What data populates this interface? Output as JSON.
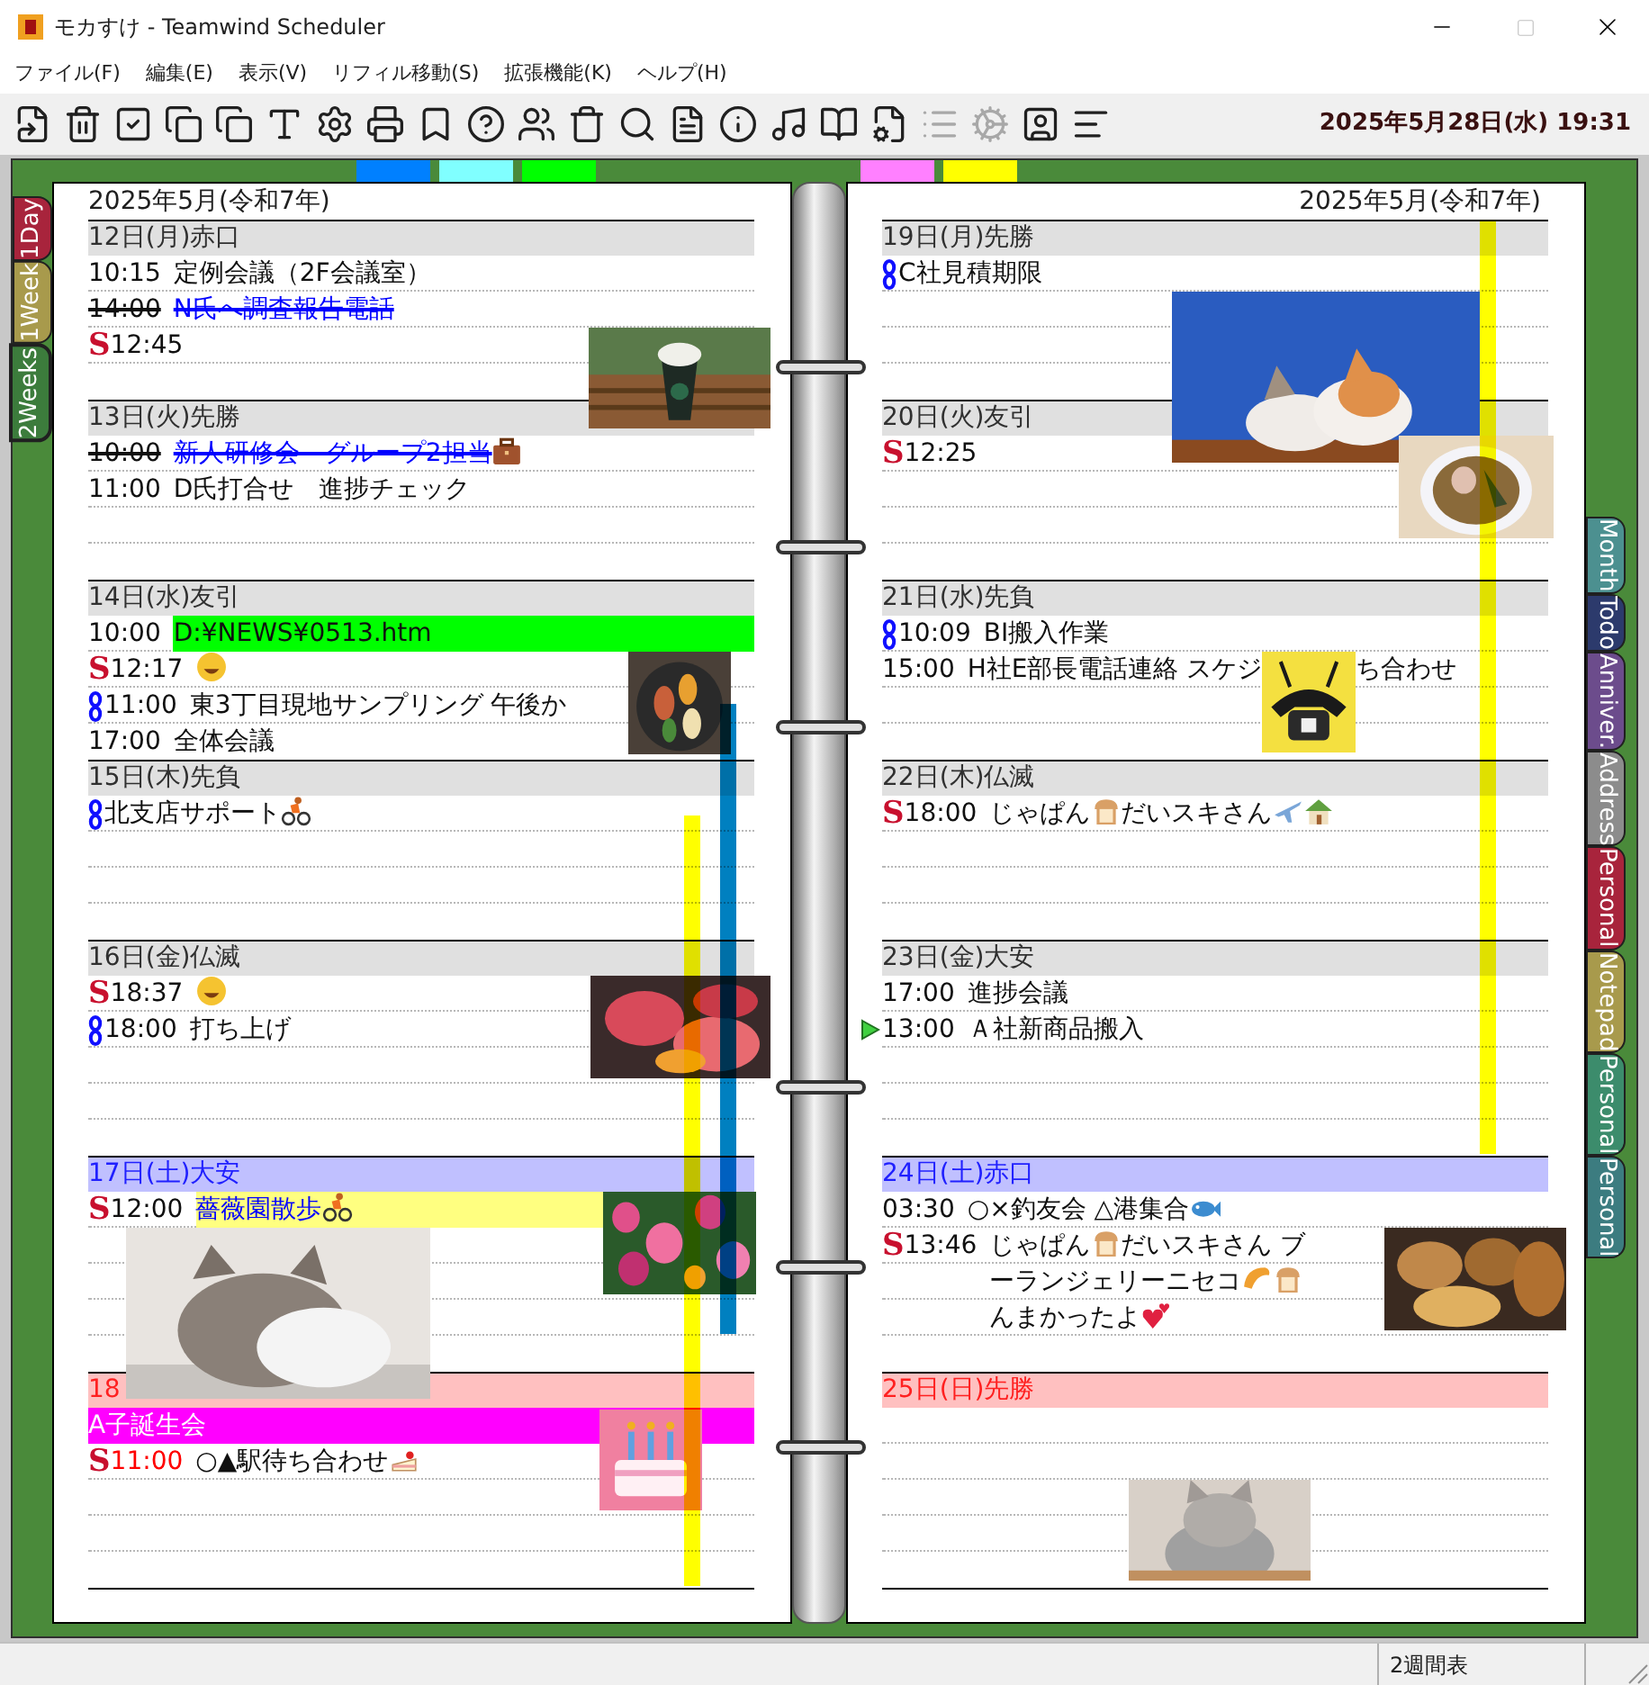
{
  "window": {
    "title": "モカすけ - Teamwind Scheduler"
  },
  "menu": [
    "ファイル(F)",
    "編集(E)",
    "表示(V)",
    "リフィル移動(S)",
    "拡張機能(K)",
    "ヘルプ(H)"
  ],
  "toolbar": [
    {
      "disabled": false
    },
    {
      "disabled": false
    },
    {
      "disabled": false
    },
    {
      "disabled": false
    },
    {
      "disabled": false
    },
    {
      "disabled": false
    },
    {
      "disabled": false
    },
    {
      "disabled": false
    },
    {
      "disabled": false
    },
    {
      "disabled": false
    },
    {
      "disabled": false
    },
    {
      "disabled": false
    },
    {
      "disabled": false
    },
    {
      "disabled": false
    },
    {
      "disabled": false
    },
    {
      "disabled": false
    },
    {
      "disabled": false
    },
    {
      "disabled": false
    },
    {
      "disabled": true
    },
    {
      "disabled": true
    },
    {
      "disabled": false
    },
    {
      "disabled": false
    }
  ],
  "clock": "2025年5月28日(水) 19:31",
  "top_markers": {
    "left": [
      {
        "color": "#0080ff"
      },
      {
        "color": "#80ffff"
      },
      {
        "color": "#00ff00"
      }
    ],
    "right": [
      {
        "color": "#ff80ff"
      },
      {
        "color": "#ffff00"
      }
    ]
  },
  "left_tabs": [
    {
      "label": "1Day",
      "color": "#a8243c",
      "selected": false
    },
    {
      "label": "1Week",
      "color": "#a89a4c",
      "selected": false
    },
    {
      "label": "2Weeks",
      "color": "#3c7c3c",
      "selected": true
    }
  ],
  "right_tabs": [
    {
      "label": "Month",
      "color": "#4c9090",
      "selected": false
    },
    {
      "label": "Todo",
      "color": "#2c3a6c",
      "selected": false
    },
    {
      "label": "Anniver.",
      "color": "#6c4c8c",
      "selected": false
    },
    {
      "label": "Address",
      "color": "#8c8c8c",
      "selected": false
    },
    {
      "label": "Personal",
      "color": "#a8243c",
      "selected": false
    },
    {
      "label": "Notepad",
      "color": "#a89a4c",
      "selected": false
    },
    {
      "label": "Personal",
      "color": "#3c8c6c",
      "selected": false
    },
    {
      "label": "Personal",
      "color": "#3c7c80",
      "selected": false
    }
  ],
  "pages": [
    {
      "month": "2025年5月(令和7年)",
      "period_bars": [
        {
          "color": "#ffff00"
        },
        {
          "color": "#0080c0"
        }
      ],
      "days": [
        {
          "header": "12日(月)赤口",
          "kind": "weekday",
          "entries": [
            {
              "kind": "plain",
              "time": "10:15",
              "parts": [
                {
                  "text": "定例会議（2F会議室）"
                }
              ],
              "strike": false
            },
            {
              "kind": "plain",
              "time": "14:00",
              "parts": [
                {
                  "text": "N氏へ調査報告電話"
                }
              ],
              "strike": true,
              "color": "#0000ff"
            },
            {
              "kind": "letter",
              "mark_text": "S",
              "time": "12:45",
              "strike": false
            }
          ]
        },
        {
          "header": "13日(火)先勝",
          "kind": "weekday",
          "entries": [
            {
              "kind": "plain",
              "time": "10:00",
              "parts": [
                {
                  "text": "新人研修会　グループ2担当"
                },
                {
                  "kind": "briefcase"
                }
              ],
              "strike": true,
              "color": "#0000ff"
            },
            {
              "kind": "plain",
              "time": "11:00",
              "parts": [
                {
                  "text": "D氏打合せ　進捗チェック"
                }
              ],
              "strike": false
            }
          ]
        },
        {
          "header": "14日(水)友引",
          "kind": "weekday",
          "entries": [
            {
              "kind": "plain",
              "time": "10:00",
              "parts": [
                {
                  "text": "D:¥NEWS¥0513.htm"
                }
              ],
              "strike": false,
              "highlight": {
                "color": "#00ff00"
              }
            },
            {
              "kind": "letter",
              "mark_text": "S",
              "time": "12:17",
              "parts": [
                {
                  "kind": "drool"
                }
              ],
              "strike": false
            },
            {
              "kind": "link",
              "time": "11:00",
              "parts": [
                {
                  "text": "東3丁目現地サンプリング 午後か"
                }
              ],
              "strike": false
            },
            {
              "kind": "plain",
              "time": "17:00",
              "parts": [
                {
                  "text": "全体会議"
                }
              ],
              "strike": false
            }
          ]
        },
        {
          "header": "15日(木)先負",
          "kind": "weekday",
          "entries": [
            {
              "kind": "link",
              "parts": [
                {
                  "text": "北支店サポート"
                },
                {
                  "kind": "cyclist"
                }
              ],
              "strike": false
            }
          ]
        },
        {
          "header": "16日(金)仏滅",
          "kind": "weekday",
          "entries": [
            {
              "kind": "letter",
              "mark_text": "S",
              "time": "18:37",
              "parts": [
                {
                  "kind": "grin"
                }
              ],
              "strike": false
            },
            {
              "kind": "link",
              "time": "18:00",
              "parts": [
                {
                  "text": "打ち上げ"
                }
              ],
              "strike": false
            }
          ]
        },
        {
          "header": "17日(土)大安",
          "kind": "saturday",
          "entries": [
            {
              "kind": "letter",
              "mark_text": "S",
              "time": "12:00",
              "parts": [
                {
                  "text": "薔薇園散歩"
                },
                {
                  "kind": "cyclist"
                }
              ],
              "strike": false,
              "highlight": {
                "color": "#ffff80"
              },
              "color": "#0000ff"
            }
          ]
        },
        {
          "header": "18",
          "kind": "sunday",
          "entries": [
            {
              "kind": "plain",
              "parts": [
                {
                  "text": "A子誕生会"
                }
              ],
              "strike": false,
              "highlight": {
                "color": "#ff00ff"
              },
              "color": "#ffffff"
            },
            {
              "kind": "letter",
              "mark_text": "S",
              "time": "11:00",
              "time_style": {
                "color": "#ff0000"
              },
              "parts": [
                {
                  "text": "○▲駅待ち合わせ"
                },
                {
                  "kind": "cake"
                }
              ],
              "strike": false
            }
          ]
        }
      ]
    },
    {
      "month": "2025年5月(令和7年)",
      "period_bars": [
        {
          "color": "#ffff00"
        }
      ],
      "days": [
        {
          "header": "19日(月)先勝",
          "kind": "weekday",
          "entries": [
            {
              "kind": "link",
              "parts": [
                {
                  "text": "C社見積期限"
                }
              ],
              "strike": false
            }
          ]
        },
        {
          "header": "20日(火)友引",
          "kind": "weekday",
          "entries": [
            {
              "kind": "letter",
              "mark_text": "S",
              "time": "12:25",
              "strike": false
            }
          ]
        },
        {
          "header": "21日(水)先負",
          "kind": "weekday",
          "entries": [
            {
              "kind": "link",
              "time": "10:09",
              "parts": [
                {
                  "text": "BI搬入作業"
                }
              ],
              "strike": false
            },
            {
              "kind": "plain",
              "time": "15:00",
              "parts": [
                {
                  "text": "H社E部長電話連絡 スケジ"
                },
                {
                  "kind": "picture"
                },
                {
                  "text": "ち合わせ"
                }
              ],
              "strike": false
            }
          ]
        },
        {
          "header": "22日(木)仏滅",
          "kind": "weekday",
          "entries": [
            {
              "kind": "letter",
              "mark_text": "S",
              "time": "18:00",
              "parts": [
                {
                  "text": "じゃぱん"
                },
                {
                  "kind": "bread"
                },
                {
                  "text": "だいスキさん"
                },
                {
                  "kind": "plane"
                },
                {
                  "kind": "house"
                }
              ],
              "strike": false
            }
          ]
        },
        {
          "header": "23日(金)大安",
          "kind": "weekday",
          "entries": [
            {
              "kind": "plain",
              "time": "17:00",
              "parts": [
                {
                  "text": "進捗会議"
                }
              ],
              "strike": false
            },
            {
              "kind": "arrow",
              "time": "13:00",
              "parts": [
                {
                  "text": "Ａ社新商品搬入"
                }
              ],
              "strike": false
            }
          ]
        },
        {
          "header": "24日(土)赤口",
          "kind": "saturday",
          "entries": [
            {
              "kind": "plain",
              "time": "03:30",
              "parts": [
                {
                  "text": "○×釣友会 △港集合"
                },
                {
                  "kind": "fish"
                }
              ],
              "strike": false
            },
            {
              "kind": "letter",
              "mark_text": "S",
              "time": "13:46",
              "parts": [
                {
                  "text": "じゃぱん"
                },
                {
                  "kind": "bread"
                },
                {
                  "text": "だいスキさん ブ"
                },
                {
                  "kind": "break"
                },
                {
                  "text": "ーランジェリーニセコ"
                },
                {
                  "kind": "croissant"
                },
                {
                  "kind": "bread"
                },
                {
                  "kind": "break"
                },
                {
                  "text": "んまかったよ"
                },
                {
                  "kind": "hearts"
                }
              ],
              "strike": false
            }
          ]
        },
        {
          "header": "25日(日)先勝",
          "kind": "sunday"
        }
      ]
    }
  ],
  "status_bar": {
    "text": "2週間表"
  }
}
